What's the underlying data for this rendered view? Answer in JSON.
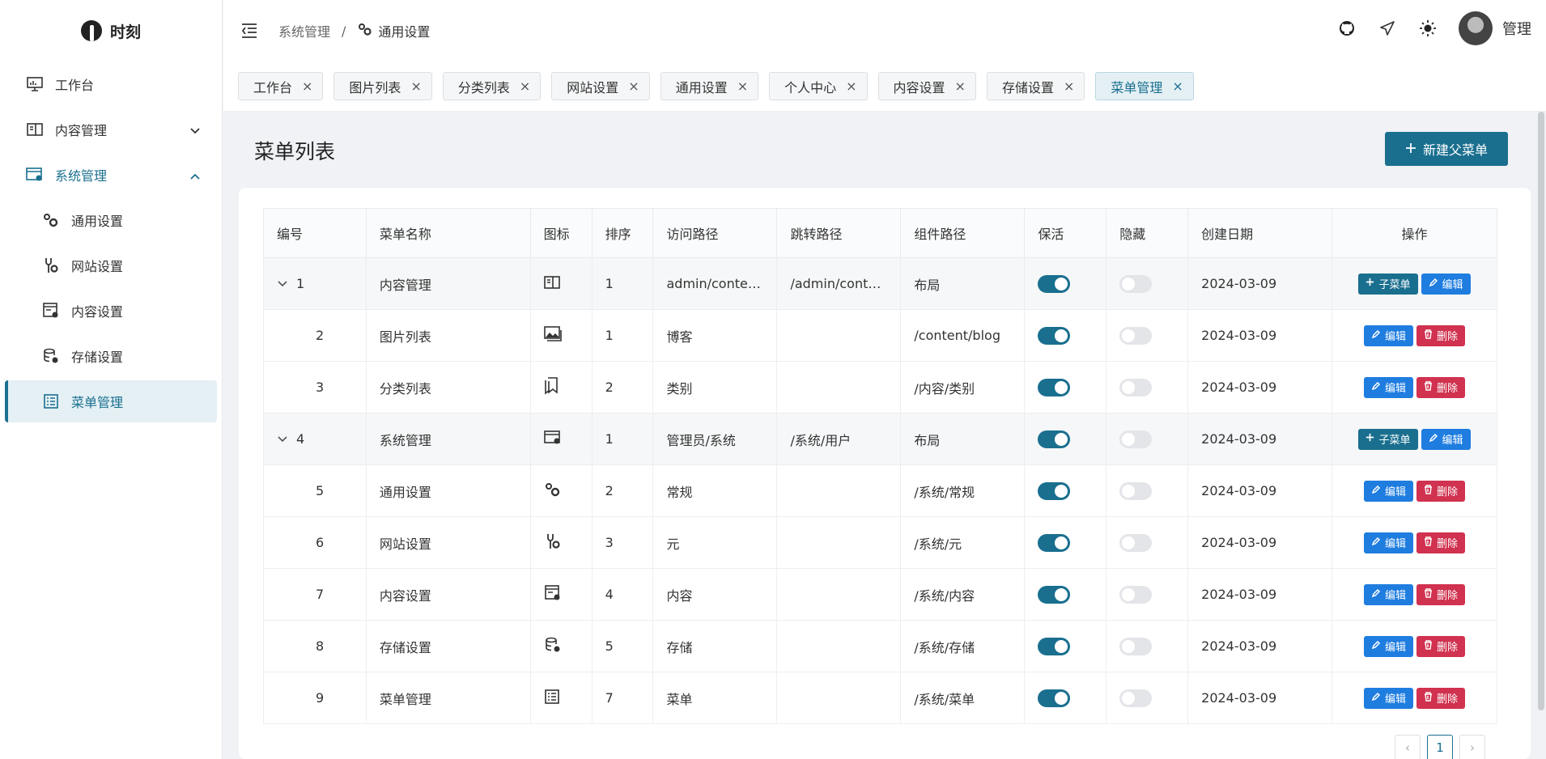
{
  "app": {
    "name": "时刻"
  },
  "sidebar": {
    "items": [
      {
        "label": "工作台",
        "icon": "monitor-icon"
      },
      {
        "label": "内容管理",
        "icon": "content-icon"
      },
      {
        "label": "系统管理",
        "icon": "system-icon"
      },
      {
        "label": "通用设置",
        "icon": "gears-icon"
      },
      {
        "label": "网站设置",
        "icon": "wrench-gear-icon"
      },
      {
        "label": "内容设置",
        "icon": "content-settings-icon"
      },
      {
        "label": "存储设置",
        "icon": "database-gear-icon"
      },
      {
        "label": "菜单管理",
        "icon": "list-icon"
      }
    ]
  },
  "header": {
    "breadcrumb_parent": "系统管理",
    "breadcrumb_sep": "/",
    "breadcrumb_current": "通用设置",
    "user_name": "管理"
  },
  "tabs": [
    {
      "label": "工作台"
    },
    {
      "label": "图片列表"
    },
    {
      "label": "分类列表"
    },
    {
      "label": "网站设置"
    },
    {
      "label": "通用设置"
    },
    {
      "label": "个人中心"
    },
    {
      "label": "内容设置"
    },
    {
      "label": "存储设置"
    },
    {
      "label": "菜单管理"
    }
  ],
  "tab_close": "×",
  "page": {
    "title": "菜单列表",
    "new_parent_label": "新建父菜单"
  },
  "table": {
    "headers": [
      "编号",
      "菜单名称",
      "图标",
      "排序",
      "访问路径",
      "跳转路径",
      "组件路径",
      "保活",
      "隐藏",
      "创建日期",
      "操作"
    ],
    "rows": [
      {
        "id": "1",
        "name": "内容管理",
        "icon": "content-icon",
        "order": "1",
        "path": "admin/conte…",
        "redirect": "/admin/cont…",
        "component": "布局",
        "keepalive": true,
        "hidden": false,
        "date": "2024-03-09",
        "parent": true
      },
      {
        "id": "2",
        "name": "图片列表",
        "icon": "images-icon",
        "order": "1",
        "path": "博客",
        "redirect": "",
        "component": "/content/blog",
        "keepalive": true,
        "hidden": false,
        "date": "2024-03-09",
        "parent": false
      },
      {
        "id": "3",
        "name": "分类列表",
        "icon": "bookmark-icon",
        "order": "2",
        "path": "类别",
        "redirect": "",
        "component": "/内容/类别",
        "keepalive": true,
        "hidden": false,
        "date": "2024-03-09",
        "parent": false
      },
      {
        "id": "4",
        "name": "系统管理",
        "icon": "system-icon",
        "order": "1",
        "path": "管理员/系统",
        "redirect": "/系统/用户",
        "component": "布局",
        "keepalive": true,
        "hidden": false,
        "date": "2024-03-09",
        "parent": true
      },
      {
        "id": "5",
        "name": "通用设置",
        "icon": "gears-icon",
        "order": "2",
        "path": "常规",
        "redirect": "",
        "component": "/系统/常规",
        "keepalive": true,
        "hidden": false,
        "date": "2024-03-09",
        "parent": false
      },
      {
        "id": "6",
        "name": "网站设置",
        "icon": "wrench-gear-icon",
        "order": "3",
        "path": "元",
        "redirect": "",
        "component": "/系统/元",
        "keepalive": true,
        "hidden": false,
        "date": "2024-03-09",
        "parent": false
      },
      {
        "id": "7",
        "name": "内容设置",
        "icon": "content-settings-icon",
        "order": "4",
        "path": "内容",
        "redirect": "",
        "component": "/系统/内容",
        "keepalive": true,
        "hidden": false,
        "date": "2024-03-09",
        "parent": false
      },
      {
        "id": "8",
        "name": "存储设置",
        "icon": "database-gear-icon",
        "order": "5",
        "path": "存储",
        "redirect": "",
        "component": "/系统/存储",
        "keepalive": true,
        "hidden": false,
        "date": "2024-03-09",
        "parent": false
      },
      {
        "id": "9",
        "name": "菜单管理",
        "icon": "list-icon",
        "order": "7",
        "path": "菜单",
        "redirect": "",
        "component": "/系统/菜单",
        "keepalive": true,
        "hidden": false,
        "date": "2024-03-09",
        "parent": false
      }
    ],
    "actions": {
      "add_child": "子菜单",
      "edit": "编辑",
      "delete": "删除"
    }
  },
  "pagination": {
    "prev": "‹",
    "current": "1",
    "next": "›"
  },
  "colors": {
    "primary": "#1a6f8f",
    "edit": "#1f7de0",
    "delete": "#d0324f"
  }
}
